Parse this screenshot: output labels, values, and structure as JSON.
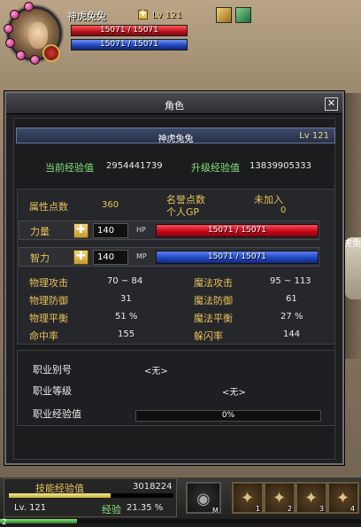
{
  "player_hud": {
    "name": "神虎兔兔",
    "level": "Lv 121",
    "hp": "15071 / 15071",
    "mp": "15071 / 15071"
  },
  "window": {
    "title": "角色",
    "close_label": "✕"
  },
  "character": {
    "name": "神虎兔兔",
    "level": "Lv 121",
    "current_exp_label": "当前经验值",
    "current_exp": "2954441739",
    "levelup_exp_label": "升级经验值",
    "levelup_exp": "13839905333",
    "attr_points_label": "属性点数",
    "attr_points": "360",
    "honor_label": "名誉点数",
    "personal_gp_label": "个人GP",
    "guild_status": "未加入",
    "personal_gp": "0"
  },
  "stats_rows": {
    "strength_label": "力量",
    "strength": "140",
    "hp_tag": "HP",
    "hp": "15071 / 15071",
    "intellect_label": "智力",
    "intellect": "140",
    "mp_tag": "MP",
    "mp": "15071 / 15071",
    "plus_label": "✚"
  },
  "attributes": {
    "phys_atk_label": "物理攻击",
    "phys_atk": "70 ~ 84",
    "mag_atk_label": "魔法攻击",
    "mag_atk": "95 ~ 113",
    "phys_def_label": "物理防御",
    "phys_def": "31",
    "mag_def_label": "魔法防御",
    "mag_def": "61",
    "phys_bal_label": "物理平衡",
    "phys_bal": "51 %",
    "mag_bal_label": "魔法平衡",
    "mag_bal": "27 %",
    "hit_label": "命中率",
    "hit": "155",
    "dodge_label": "躲闪率",
    "dodge": "144"
  },
  "job": {
    "alias_label": "职业别号",
    "alias": "<无>",
    "level_label": "职业等级",
    "level": "<无>",
    "exp_label": "职业经验值",
    "exp": "0%",
    "exp_fraction": 0
  },
  "bottom_bar": {
    "skill_exp_label": "技能经验值",
    "skill_exp": "3018224",
    "skill_exp_fraction": 0.62,
    "level": "Lv. 121",
    "exp_label": "经验",
    "exp_pct": "21.35 %",
    "exp_fraction": 0.2135,
    "page": "2",
    "slots": [
      {
        "icon": "mount-icon",
        "key": "M"
      },
      {
        "icon": "skill-icon",
        "key": "1"
      },
      {
        "icon": "skill-icon",
        "key": "2"
      },
      {
        "icon": "skill-icon",
        "key": "3"
      },
      {
        "icon": "skill-icon",
        "key": "4"
      }
    ]
  },
  "background": {
    "npc_name_fragment": "虎兔"
  }
}
